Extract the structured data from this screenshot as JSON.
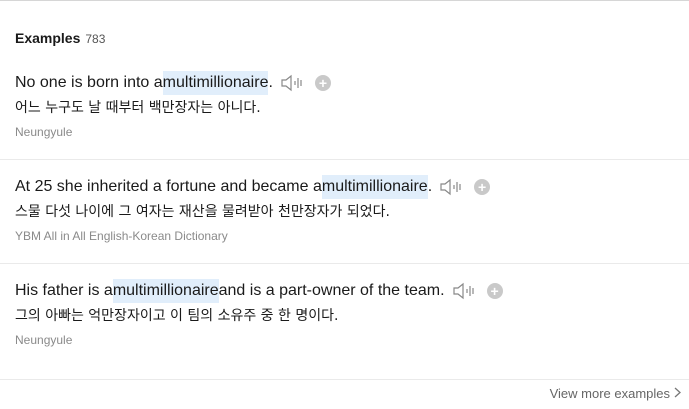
{
  "section": {
    "title": "Examples",
    "count": "783"
  },
  "examples": [
    {
      "en_before": "No one is born into a ",
      "en_highlight": "multimillionaire",
      "en_after": ".",
      "ko": "어느 누구도 날 때부터 백만장자는 아니다.",
      "source": "Neungyule"
    },
    {
      "en_before": "At 25 she inherited a fortune and became a ",
      "en_highlight": "multimillionaire",
      "en_after": ".",
      "ko": "스물 다섯 나이에 그 여자는 재산을 물려받아 천만장자가 되었다.",
      "source": "YBM All in All English-Korean Dictionary"
    },
    {
      "en_before": "His father is a ",
      "en_highlight": "multimillionaire",
      "en_after": " and is a part-owner of the team.",
      "ko": "그의 아빠는 억만장자이고 이 팀의 소유주 중 한 명이다.",
      "source": "Neungyule"
    }
  ],
  "icons": {
    "audio": "speaker-icon",
    "add": "plus-circle-icon",
    "more": "chevron-right-icon"
  },
  "plus_glyph": "+",
  "footer": {
    "view_more": "View more examples"
  },
  "colors": {
    "highlight": "#e1eefb",
    "source_text": "#8a8a8a",
    "icon_gray": "#c9c9c9"
  }
}
